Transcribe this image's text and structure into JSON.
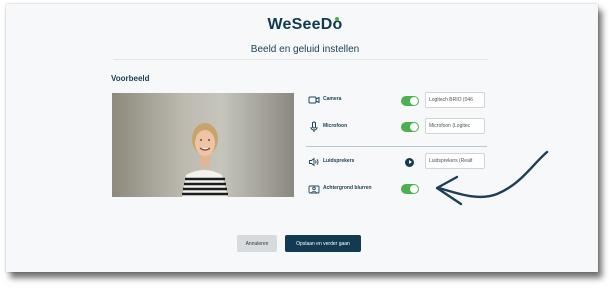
{
  "app": {
    "name": "WeSeeDo"
  },
  "header": {
    "title": "Beeld en geluid instellen"
  },
  "preview": {
    "label": "Voorbeeld"
  },
  "settings": {
    "camera": {
      "label": "Camera",
      "enabled": true,
      "device": "Logitech BRIO (046"
    },
    "microphone": {
      "label": "Microfoon",
      "enabled": true,
      "device": "Microfoon (Logitec"
    },
    "speakers": {
      "label": "Luidsprekers",
      "device": "Luidsprekers (Realt"
    },
    "background_blur": {
      "label": "Achtergrond blurren",
      "enabled": true
    }
  },
  "actions": {
    "cancel_label": "Annuleren",
    "save_label": "Opslaan en verder gaan"
  },
  "colors": {
    "brand": "#0f3b50",
    "accent_green": "#4caf50",
    "toggle_on": "#4caf50"
  }
}
